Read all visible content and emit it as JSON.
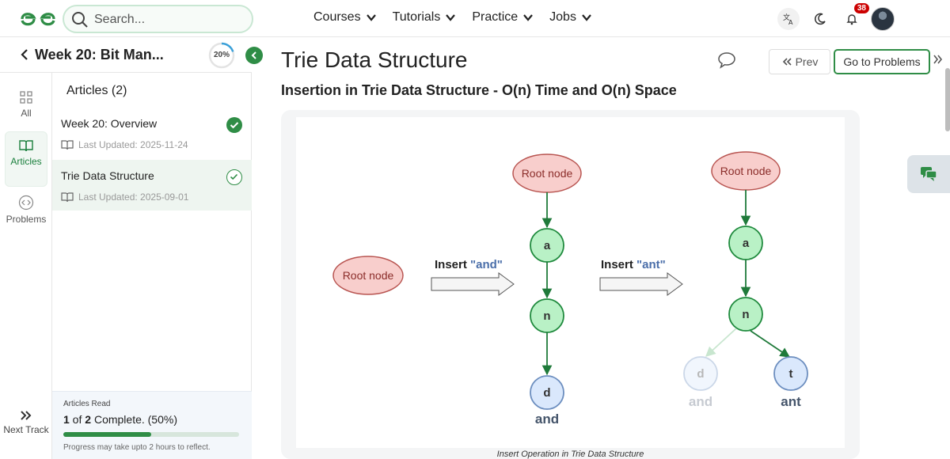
{
  "header": {
    "search_placeholder": "Search...",
    "nav": [
      {
        "label": "Courses"
      },
      {
        "label": "Tutorials"
      },
      {
        "label": "Practice"
      },
      {
        "label": "Jobs"
      }
    ],
    "notification_count": "38",
    "icons": [
      "logo-icon",
      "search-icon",
      "translate-icon",
      "moon-icon",
      "bell-icon",
      "avatar"
    ]
  },
  "rail": {
    "items": [
      {
        "label": "All",
        "icon": "grid-icon"
      },
      {
        "label": "Articles",
        "icon": "book-icon"
      },
      {
        "label": "Problems",
        "icon": "code-icon"
      }
    ],
    "next_track": "Next Track"
  },
  "panel": {
    "title": "Week 20: Bit Man...",
    "progress": "20%",
    "progress_fraction": 0.2,
    "section": "Articles (2)",
    "articles": [
      {
        "name": "Week 20: Overview",
        "updated": "Last Updated: 2025-11-24",
        "status": "complete"
      },
      {
        "name": "Trie Data Structure",
        "updated": "Last Updated: 2025-09-01",
        "status": "current"
      }
    ],
    "read": {
      "label": "Articles Read",
      "count_a": "1",
      "count_of": " of ",
      "count_b": "2",
      "complete_text": " Complete. (50%)",
      "fraction": 0.5,
      "note": "Progress may take upto 2 hours to reflect."
    }
  },
  "main": {
    "title": "Trie Data Structure",
    "subtitle": "Insertion in Trie Data Structure - O(n) Time and O(n) Space",
    "prev_label": "Prev",
    "goto_label": "Go to Problems",
    "caption": "Insert Operation in Trie Data Structure"
  },
  "diagram": {
    "root_label": "Root node",
    "insert_prefix": "Insert ",
    "insert_and": "\"and\"",
    "insert_ant": "\"ant\"",
    "nodes_a": "a",
    "nodes_n": "n",
    "nodes_d": "d",
    "nodes_t": "t",
    "word_and": "and",
    "word_ant": "ant",
    "colors": {
      "root_fill": "#f8cecc",
      "root_stroke": "#b85450",
      "node_fill": "#b9f1c6",
      "node_stroke": "#1f8a3d",
      "leaf_fill": "#dae8fc",
      "leaf_stroke": "#6c8ebf",
      "edge": "#1f7a3a"
    }
  }
}
